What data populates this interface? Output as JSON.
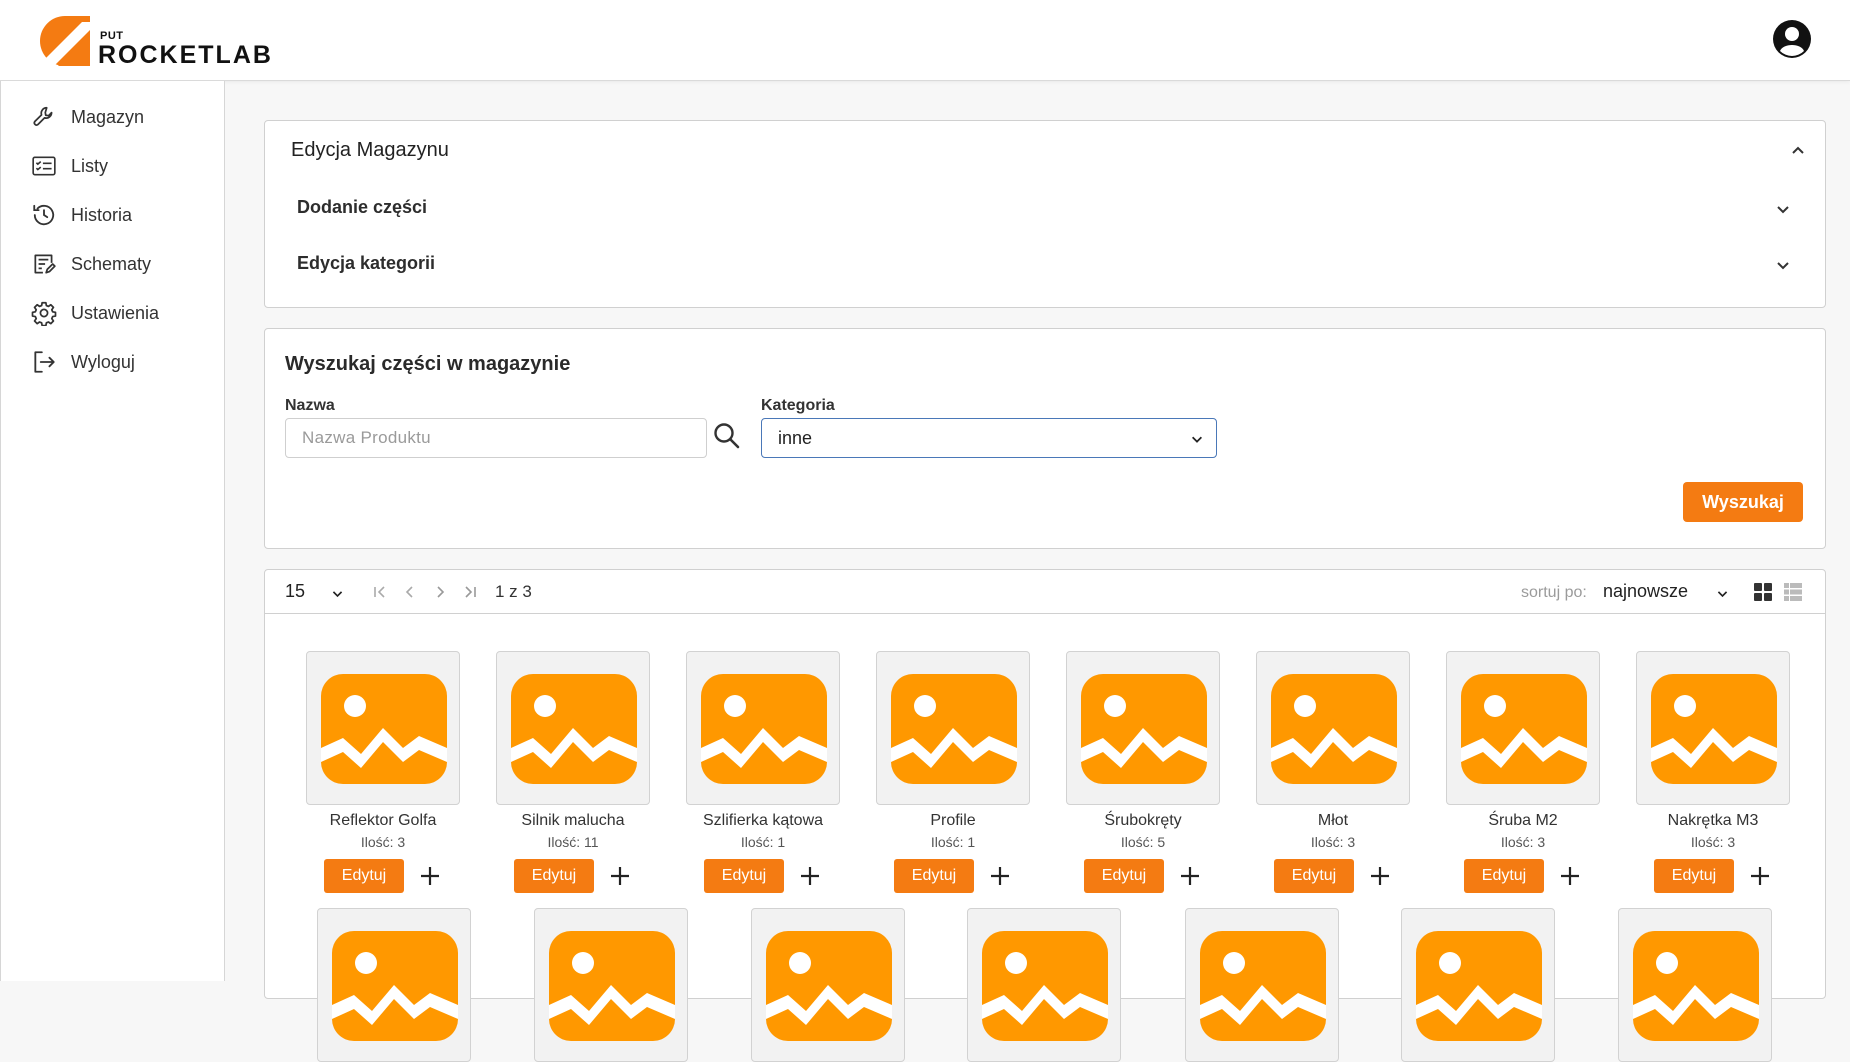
{
  "app": {
    "logo_small": "PUT",
    "logo_name": "ROCKETLAB"
  },
  "sidebar": {
    "items": [
      {
        "label": "Magazyn",
        "icon": "wrench-icon"
      },
      {
        "label": "Listy",
        "icon": "checklist-icon"
      },
      {
        "label": "Historia",
        "icon": "history-icon"
      },
      {
        "label": "Schematy",
        "icon": "schema-edit-icon"
      },
      {
        "label": "Ustawienia",
        "icon": "gear-icon"
      },
      {
        "label": "Wyloguj",
        "icon": "logout-icon"
      }
    ]
  },
  "edit_panel": {
    "title": "Edycja Magazynu",
    "sections": [
      "Dodanie części",
      "Edycja kategorii"
    ]
  },
  "search_panel": {
    "title": "Wyszukaj części w magazynie",
    "name_label": "Nazwa",
    "name_placeholder": "Nazwa Produktu",
    "name_value": "",
    "category_label": "Kategoria",
    "category_value": "inne",
    "search_button": "Wyszukaj"
  },
  "results": {
    "per_page": "15",
    "page_info": "1 z 3",
    "sort_label": "sortuj po:",
    "sort_value": "najnowsze",
    "edit_label": "Edytuj",
    "products": [
      {
        "name": "Reflektor Golfa",
        "qty": "Ilość: 3"
      },
      {
        "name": "Silnik malucha",
        "qty": "Ilość: 11"
      },
      {
        "name": "Szlifierka kątowa",
        "qty": "Ilość: 1"
      },
      {
        "name": "Profile",
        "qty": "Ilość: 1"
      },
      {
        "name": "Śrubokręty",
        "qty": "Ilość: 5"
      },
      {
        "name": "Młot",
        "qty": "Ilość: 3"
      },
      {
        "name": "Śruba M2",
        "qty": "Ilość: 3"
      },
      {
        "name": "Nakrętka M3",
        "qty": "Ilość: 3"
      }
    ]
  },
  "colors": {
    "accent": "#f47b12",
    "placeholder_image": "#ff9800"
  }
}
